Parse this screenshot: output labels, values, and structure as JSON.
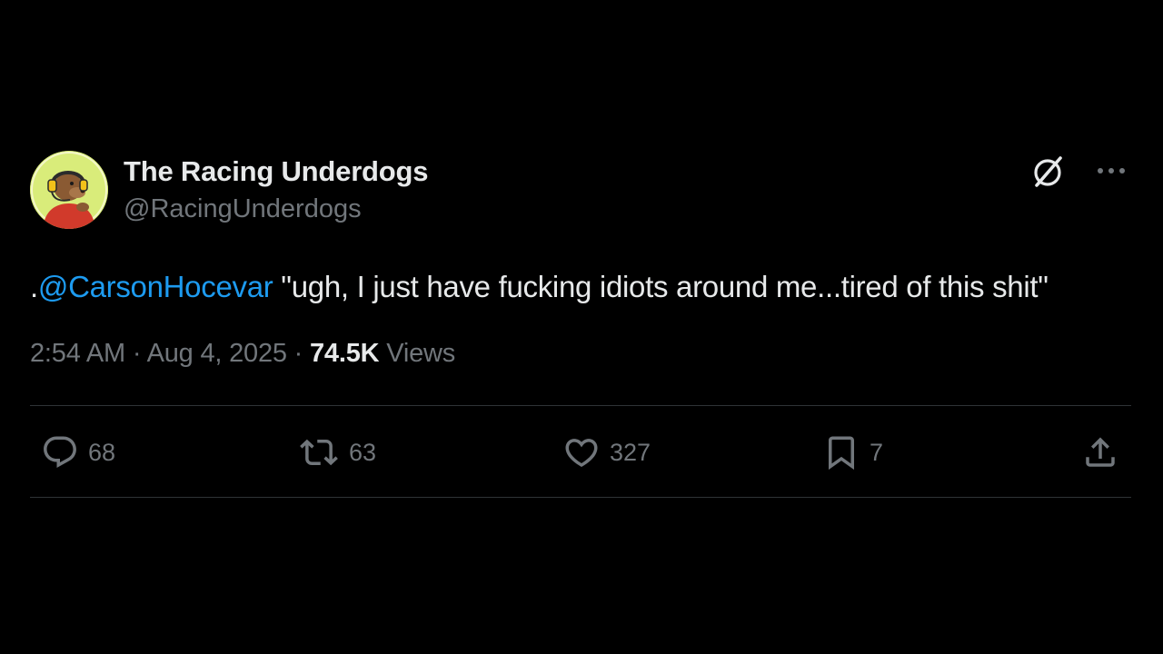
{
  "tweet": {
    "display_name": "The Racing Underdogs",
    "handle": "@RacingUnderdogs",
    "text_prefix": ".",
    "mention": "@CarsonHocevar",
    "text_rest": " \"ugh, I just have fucking idiots around me...tired of this shit\"",
    "time": "2:54 AM",
    "separator": "·",
    "date": "Aug 4, 2025",
    "views_count": "74.5K",
    "views_label": " Views"
  },
  "actions": {
    "replies": "68",
    "reposts": "63",
    "likes": "327",
    "bookmarks": "7"
  },
  "icons": {
    "reply": "reply-bubble-icon",
    "repost": "repost-arrows-icon",
    "like": "heart-icon",
    "bookmark": "bookmark-icon",
    "share": "share-upload-icon",
    "grok": "grok-slash-circle-icon",
    "more": "more-dots-icon"
  },
  "colors": {
    "background": "#000000",
    "text": "#e7e9ea",
    "secondary": "#71767b",
    "link": "#1d9bf0",
    "divider": "#2f3336",
    "avatar_bg": "#d9ec7a"
  }
}
